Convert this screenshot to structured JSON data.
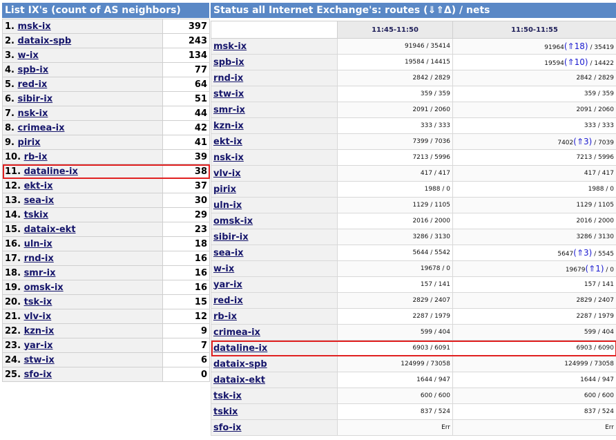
{
  "left": {
    "title": "List IX's (count of AS neighbors)",
    "rows": [
      {
        "rank": "1.",
        "name": "msk-ix",
        "count": "397"
      },
      {
        "rank": "2.",
        "name": "dataix-spb",
        "count": "243"
      },
      {
        "rank": "3.",
        "name": "w-ix",
        "count": "134"
      },
      {
        "rank": "4.",
        "name": "spb-ix",
        "count": "77"
      },
      {
        "rank": "5.",
        "name": "red-ix",
        "count": "64"
      },
      {
        "rank": "6.",
        "name": "sibir-ix",
        "count": "51"
      },
      {
        "rank": "7.",
        "name": "nsk-ix",
        "count": "44"
      },
      {
        "rank": "8.",
        "name": "crimea-ix",
        "count": "42"
      },
      {
        "rank": "9.",
        "name": "pirix",
        "count": "41"
      },
      {
        "rank": "10.",
        "name": "rb-ix",
        "count": "39"
      },
      {
        "rank": "11.",
        "name": "dataline-ix",
        "count": "38",
        "highlight": true
      },
      {
        "rank": "12.",
        "name": "ekt-ix",
        "count": "37"
      },
      {
        "rank": "13.",
        "name": "sea-ix",
        "count": "30"
      },
      {
        "rank": "14.",
        "name": "tskix",
        "count": "29"
      },
      {
        "rank": "15.",
        "name": "dataix-ekt",
        "count": "23"
      },
      {
        "rank": "16.",
        "name": "uln-ix",
        "count": "18"
      },
      {
        "rank": "17.",
        "name": "rnd-ix",
        "count": "16"
      },
      {
        "rank": "18.",
        "name": "smr-ix",
        "count": "16"
      },
      {
        "rank": "19.",
        "name": "omsk-ix",
        "count": "16"
      },
      {
        "rank": "20.",
        "name": "tsk-ix",
        "count": "15"
      },
      {
        "rank": "21.",
        "name": "vlv-ix",
        "count": "12"
      },
      {
        "rank": "22.",
        "name": "kzn-ix",
        "count": "9"
      },
      {
        "rank": "23.",
        "name": "yar-ix",
        "count": "7"
      },
      {
        "rank": "24.",
        "name": "stw-ix",
        "count": "6"
      },
      {
        "rank": "25.",
        "name": "sfo-ix",
        "count": "0"
      }
    ]
  },
  "right": {
    "title": "Status all Internet Exchange's: routes (⇓⇑Δ) / nets",
    "col1": "11:45-11:50",
    "col2": "11:50-11:55",
    "rows": [
      {
        "name": "msk-ix",
        "a": "91946 / 35414",
        "b_r": "91964",
        "b_d": "(⇑18)",
        "b_n": " / 35419"
      },
      {
        "name": "spb-ix",
        "a": "19584 / 14415",
        "b_r": "19594",
        "b_d": "(⇑10)",
        "b_n": " / 14422"
      },
      {
        "name": "rnd-ix",
        "a": "2842 / 2829",
        "b_r": "2842 / 2829",
        "b_d": "",
        "b_n": ""
      },
      {
        "name": "stw-ix",
        "a": "359 / 359",
        "b_r": "359 / 359",
        "b_d": "",
        "b_n": ""
      },
      {
        "name": "smr-ix",
        "a": "2091 / 2060",
        "b_r": "2091 / 2060",
        "b_d": "",
        "b_n": ""
      },
      {
        "name": "kzn-ix",
        "a": "333 / 333",
        "b_r": "333 / 333",
        "b_d": "",
        "b_n": ""
      },
      {
        "name": "ekt-ix",
        "a": "7399 / 7036",
        "b_r": "7402",
        "b_d": "(⇑3)",
        "b_n": " / 7039"
      },
      {
        "name": "nsk-ix",
        "a": "7213 / 5996",
        "b_r": "7213 / 5996",
        "b_d": "",
        "b_n": ""
      },
      {
        "name": "vlv-ix",
        "a": "417 / 417",
        "b_r": "417 / 417",
        "b_d": "",
        "b_n": ""
      },
      {
        "name": "pirix",
        "a": "1988 / 0",
        "b_r": "1988 / 0",
        "b_d": "",
        "b_n": ""
      },
      {
        "name": "uln-ix",
        "a": "1129 / 1105",
        "b_r": "1129 / 1105",
        "b_d": "",
        "b_n": ""
      },
      {
        "name": "omsk-ix",
        "a": "2016 / 2000",
        "b_r": "2016 / 2000",
        "b_d": "",
        "b_n": ""
      },
      {
        "name": "sibir-ix",
        "a": "3286 / 3130",
        "b_r": "3286 / 3130",
        "b_d": "",
        "b_n": ""
      },
      {
        "name": "sea-ix",
        "a": "5644 / 5542",
        "b_r": "5647",
        "b_d": "(⇑3)",
        "b_n": " / 5545"
      },
      {
        "name": "w-ix",
        "a": "19678 / 0",
        "b_r": "19679",
        "b_d": "(⇑1)",
        "b_n": " / 0"
      },
      {
        "name": "yar-ix",
        "a": "157 / 141",
        "b_r": "157 / 141",
        "b_d": "",
        "b_n": ""
      },
      {
        "name": "red-ix",
        "a": "2829 / 2407",
        "b_r": "2829 / 2407",
        "b_d": "",
        "b_n": ""
      },
      {
        "name": "rb-ix",
        "a": "2287 / 1979",
        "b_r": "2287 / 1979",
        "b_d": "",
        "b_n": ""
      },
      {
        "name": "crimea-ix",
        "a": "599 / 404",
        "b_r": "599 / 404",
        "b_d": "",
        "b_n": ""
      },
      {
        "name": "dataline-ix",
        "a": "6903 / 6091",
        "b_r": "6903 / 6090",
        "b_d": "",
        "b_n": "",
        "highlight": true
      },
      {
        "name": "dataix-spb",
        "a": "124999 / 73058",
        "b_r": "124999 / 73058",
        "b_d": "",
        "b_n": ""
      },
      {
        "name": "dataix-ekt",
        "a": "1644 / 947",
        "b_r": "1644 / 947",
        "b_d": "",
        "b_n": ""
      },
      {
        "name": "tsk-ix",
        "a": "600 / 600",
        "b_r": "600 / 600",
        "b_d": "",
        "b_n": ""
      },
      {
        "name": "tskix",
        "a": "837 / 524",
        "b_r": "837 / 524",
        "b_d": "",
        "b_n": ""
      },
      {
        "name": "sfo-ix",
        "a": "Err",
        "b_r": "Err",
        "b_d": "",
        "b_n": ""
      }
    ]
  }
}
